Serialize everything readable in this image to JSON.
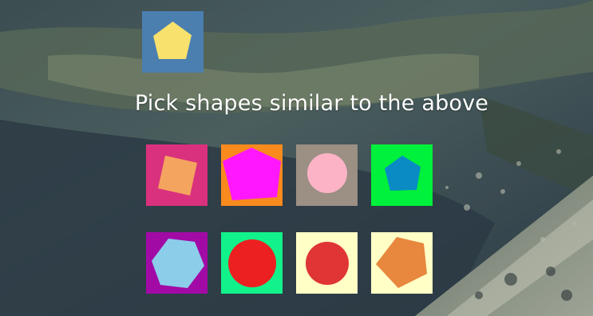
{
  "prompt": "Pick shapes similar to the above",
  "reference": {
    "shape": "pentagon-icon",
    "bg": "#4a7fb0",
    "fg": "#f8e16c"
  },
  "options": [
    {
      "shape": "square",
      "bg": "#d9317e",
      "fg": "#f4a45f"
    },
    {
      "shape": "pentagon",
      "bg": "#f88a1e",
      "fg": "#ff18ff"
    },
    {
      "shape": "circle",
      "bg": "#9c8f84",
      "fg": "#fcb3c6"
    },
    {
      "shape": "pentagon",
      "bg": "#00f13b",
      "fg": "#0a8bc4"
    },
    {
      "shape": "hexagon",
      "bg": "#a20aa6",
      "fg": "#8ccdea"
    },
    {
      "shape": "circle",
      "bg": "#12f28a",
      "fg": "#ec2020"
    },
    {
      "shape": "circle",
      "bg": "#ffffc6",
      "fg": "#e03535"
    },
    {
      "shape": "pentagon",
      "bg": "#ffffc6",
      "fg": "#e8873e"
    }
  ]
}
